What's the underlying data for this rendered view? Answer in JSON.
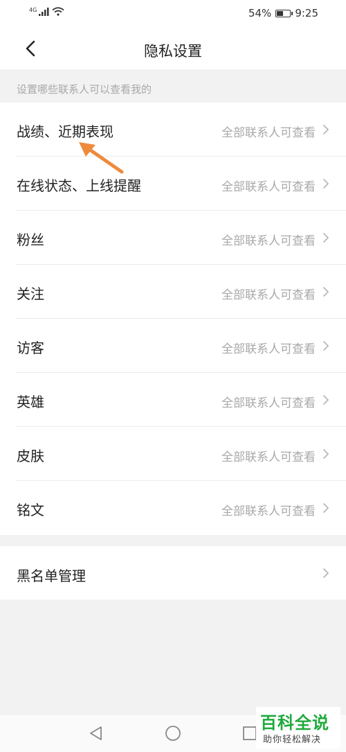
{
  "status_bar": {
    "network": "4G",
    "battery_text": "54%",
    "battery_level": 0.54,
    "time": "9:25"
  },
  "header": {
    "title": "隐私设置",
    "back_icon": "chevron-left-icon"
  },
  "section": {
    "caption": "设置哪些联系人可以查看我的"
  },
  "privacy_items": [
    {
      "label": "战绩、近期表现",
      "value": "全部联系人可查看"
    },
    {
      "label": "在线状态、上线提醒",
      "value": "全部联系人可查看"
    },
    {
      "label": "粉丝",
      "value": "全部联系人可查看"
    },
    {
      "label": "关注",
      "value": "全部联系人可查看"
    },
    {
      "label": "访客",
      "value": "全部联系人可查看"
    },
    {
      "label": "英雄",
      "value": "全部联系人可查看"
    },
    {
      "label": "皮肤",
      "value": "全部联系人可查看"
    },
    {
      "label": "铭文",
      "value": "全部联系人可查看"
    }
  ],
  "blacklist": {
    "label": "黑名单管理"
  },
  "colors": {
    "annotation_arrow": "#ee8a3c",
    "watermark_green": "#1faa3c"
  },
  "watermark": {
    "title": "百科全说",
    "subtitle": "助你轻松解决"
  }
}
